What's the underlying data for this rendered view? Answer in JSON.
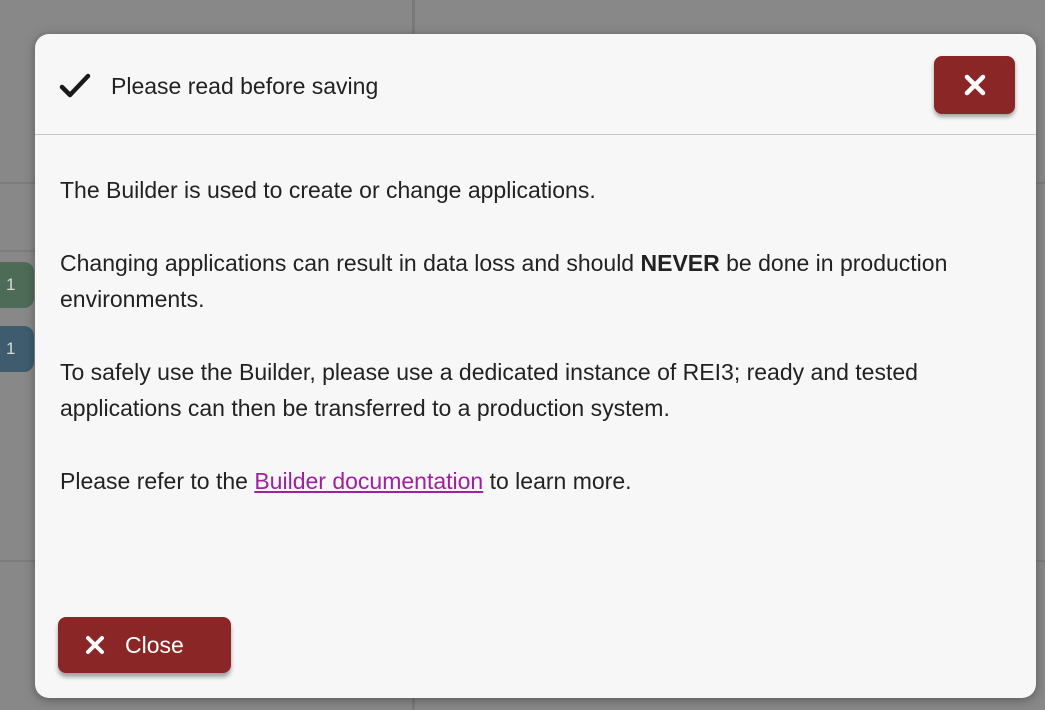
{
  "background": {
    "counters": [
      "1",
      "1"
    ]
  },
  "dialog": {
    "title": "Please read before saving",
    "header_icon": "checkmark-icon",
    "header_close_icon": "close-icon",
    "paragraph1": "The Builder is used to create or change applications.",
    "paragraph2_before": "Changing applications can result in data loss and should ",
    "paragraph2_bold": "NEVER",
    "paragraph2_after": " be done in production environments.",
    "paragraph3": "To safely use the Builder, please use a dedicated instance of REI3; ready and tested applications can then be transferred to a production system.",
    "paragraph4_before": "Please refer to the ",
    "paragraph4_link": "Builder documentation",
    "paragraph4_after": " to learn more.",
    "close_label": "Close"
  },
  "colors": {
    "button_red": "#8b2626",
    "link_purple": "#a020a0",
    "counter_green": "#4e6b58",
    "counter_blue": "#3e5c6e"
  }
}
